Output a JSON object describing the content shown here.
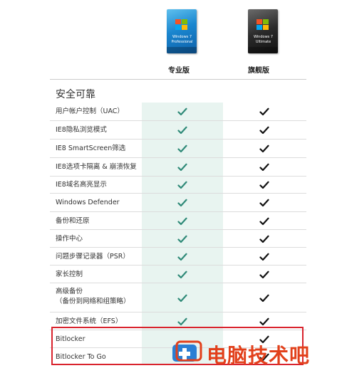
{
  "products": [
    {
      "label": "专业版",
      "box_lines": [
        "Windows 7",
        "Professional"
      ],
      "brand": "Microsoft"
    },
    {
      "label": "旗舰版",
      "box_lines": [
        "Windows 7",
        "Ultimate"
      ],
      "brand": "Microsoft"
    }
  ],
  "section_title": "安全可靠",
  "features": [
    {
      "label": "用户帐户控制（UAC）",
      "pro": true,
      "ult": true
    },
    {
      "label": "IE8隐私浏览模式",
      "pro": true,
      "ult": true
    },
    {
      "label": "IE8 SmartScreen筛选",
      "pro": true,
      "ult": true
    },
    {
      "label": "IE8选项卡隔离 & 崩溃恢复",
      "pro": true,
      "ult": true
    },
    {
      "label": "IE8域名高亮显示",
      "pro": true,
      "ult": true
    },
    {
      "label": "Windows Defender",
      "pro": true,
      "ult": true
    },
    {
      "label": "备份和还原",
      "pro": true,
      "ult": true
    },
    {
      "label": "操作中心",
      "pro": true,
      "ult": true
    },
    {
      "label": "问题步骤记录器（PSR）",
      "pro": true,
      "ult": true
    },
    {
      "label": "家长控制",
      "pro": true,
      "ult": true
    },
    {
      "label": "高级备份",
      "label_line2": "（备份到网络和组策略）",
      "pro": true,
      "ult": true
    },
    {
      "label": "加密文件系统（EFS）",
      "pro": true,
      "ult": true
    },
    {
      "label": "Bitlocker",
      "pro": false,
      "ult": true
    },
    {
      "label": "Bitlocker To Go",
      "pro": false,
      "ult": true
    }
  ],
  "watermark": {
    "text": "电脑技术吧"
  },
  "colors": {
    "pro_check": "#2f8a78",
    "ult_check": "#111111",
    "pro_column_bg": "#e8f4f0",
    "highlight_border": "#d9232d",
    "watermark": "#e2401b"
  }
}
